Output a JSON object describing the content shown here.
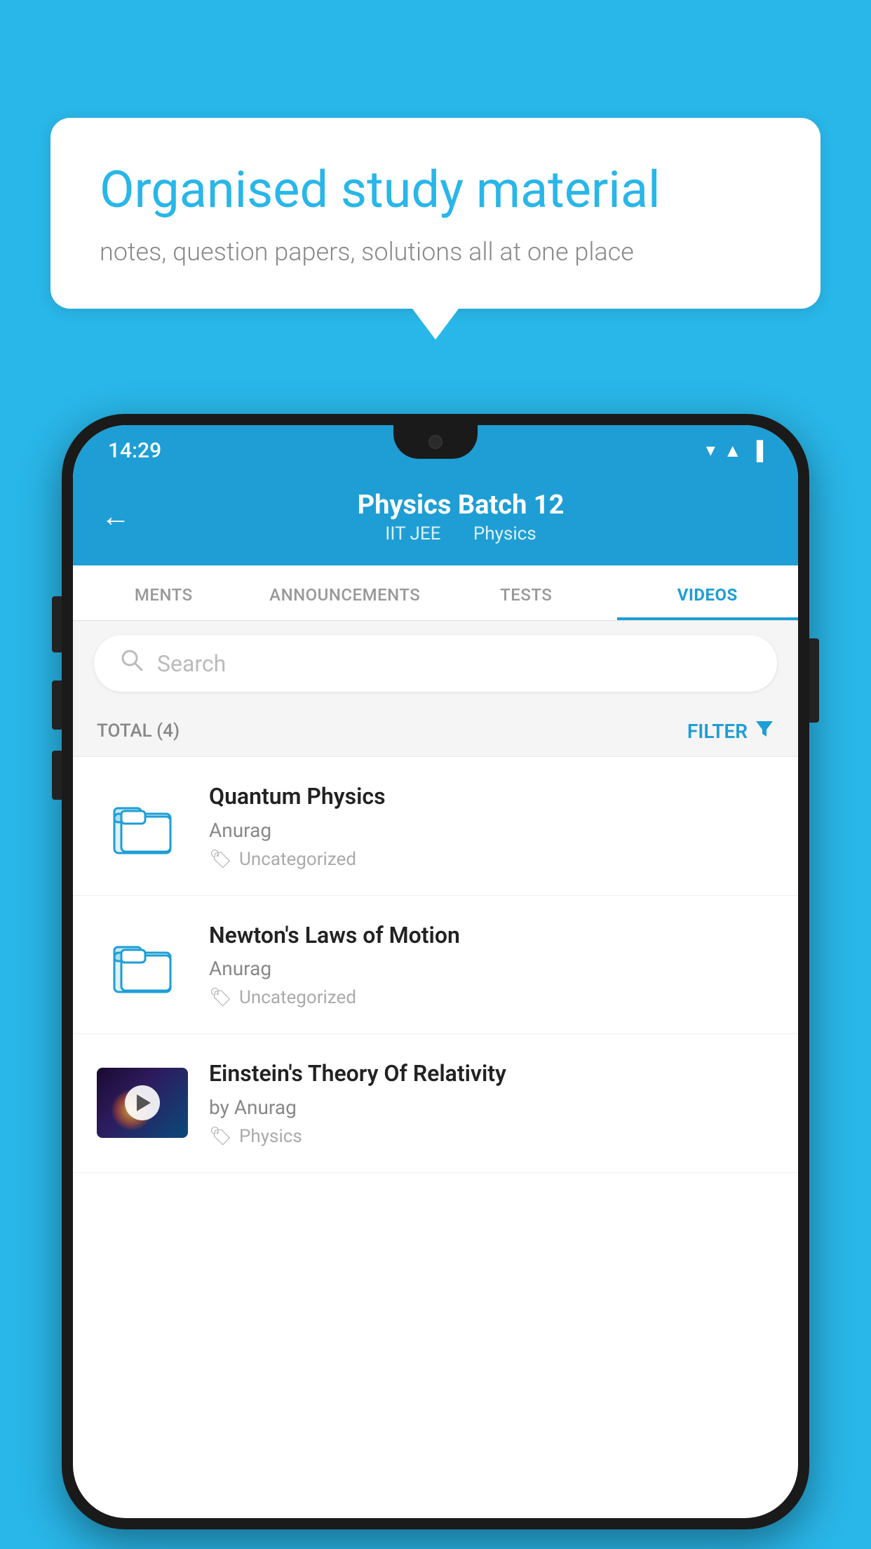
{
  "background_color": "#29B6E8",
  "hero": {
    "title": "Organised study material",
    "subtitle": "notes, question papers, solutions all at one place"
  },
  "phone": {
    "status_bar": {
      "time": "14:29",
      "wifi": "▼",
      "signal": "▲",
      "battery": "▐"
    },
    "header": {
      "back_label": "←",
      "title": "Physics Batch 12",
      "subtitle_part1": "IIT JEE",
      "subtitle_part2": "Physics"
    },
    "tabs": [
      {
        "label": "MENTS",
        "active": false
      },
      {
        "label": "ANNOUNCEMENTS",
        "active": false
      },
      {
        "label": "TESTS",
        "active": false
      },
      {
        "label": "VIDEOS",
        "active": true
      }
    ],
    "search": {
      "placeholder": "Search"
    },
    "filter": {
      "total_label": "TOTAL (4)",
      "filter_label": "FILTER"
    },
    "videos": [
      {
        "id": 1,
        "title": "Quantum Physics",
        "author": "Anurag",
        "tag": "Uncategorized",
        "type": "folder"
      },
      {
        "id": 2,
        "title": "Newton's Laws of Motion",
        "author": "Anurag",
        "tag": "Uncategorized",
        "type": "folder"
      },
      {
        "id": 3,
        "title": "Einstein's Theory Of Relativity",
        "author": "by Anurag",
        "tag": "Physics",
        "type": "video"
      }
    ]
  }
}
